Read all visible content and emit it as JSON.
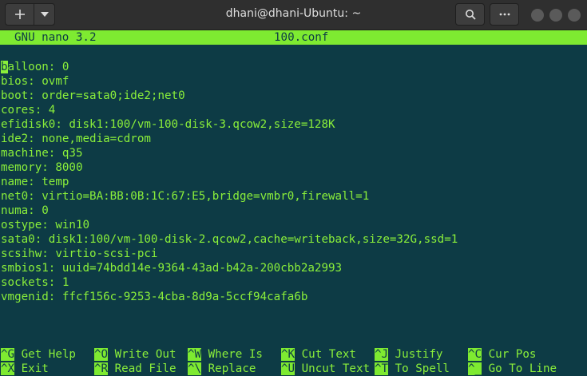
{
  "window": {
    "title": "dhani@dhani-Ubuntu: ~"
  },
  "nano": {
    "version": "GNU nano 3.2",
    "filename": "100.conf"
  },
  "file": {
    "first_char": "b",
    "first_rest": "alloon: 0",
    "lines": [
      "bios: ovmf",
      "boot: order=sata0;ide2;net0",
      "cores: 4",
      "efidisk0: disk1:100/vm-100-disk-3.qcow2,size=128K",
      "ide2: none,media=cdrom",
      "machine: q35",
      "memory: 8000",
      "name: temp",
      "net0: virtio=BA:BB:0B:1C:67:E5,bridge=vmbr0,firewall=1",
      "numa: 0",
      "ostype: win10",
      "sata0: disk1:100/vm-100-disk-2.qcow2,cache=writeback,size=32G,ssd=1",
      "scsihw: virtio-scsi-pci",
      "smbios1: uuid=74bdd14e-9364-43ad-b42a-200cbb2a2993",
      "sockets: 1",
      "vmgenid: ffcf156c-9253-4cba-8d9a-5ccf94cafa6b"
    ]
  },
  "shortcuts": [
    {
      "key": "^G",
      "label": "Get Help"
    },
    {
      "key": "^O",
      "label": "Write Out"
    },
    {
      "key": "^W",
      "label": "Where Is"
    },
    {
      "key": "^K",
      "label": "Cut Text"
    },
    {
      "key": "^J",
      "label": "Justify"
    },
    {
      "key": "^C",
      "label": "Cur Pos"
    },
    {
      "key": "^X",
      "label": "Exit"
    },
    {
      "key": "^R",
      "label": "Read File"
    },
    {
      "key": "^\\",
      "label": "Replace"
    },
    {
      "key": "^U",
      "label": "Uncut Text"
    },
    {
      "key": "^T",
      "label": "To Spell"
    },
    {
      "key": "^_",
      "label": "Go To Line"
    }
  ],
  "icons": {
    "new_tab": "plus-icon",
    "menu": "chevron-down-icon",
    "search": "search-icon",
    "more": "ellipsis-icon"
  }
}
